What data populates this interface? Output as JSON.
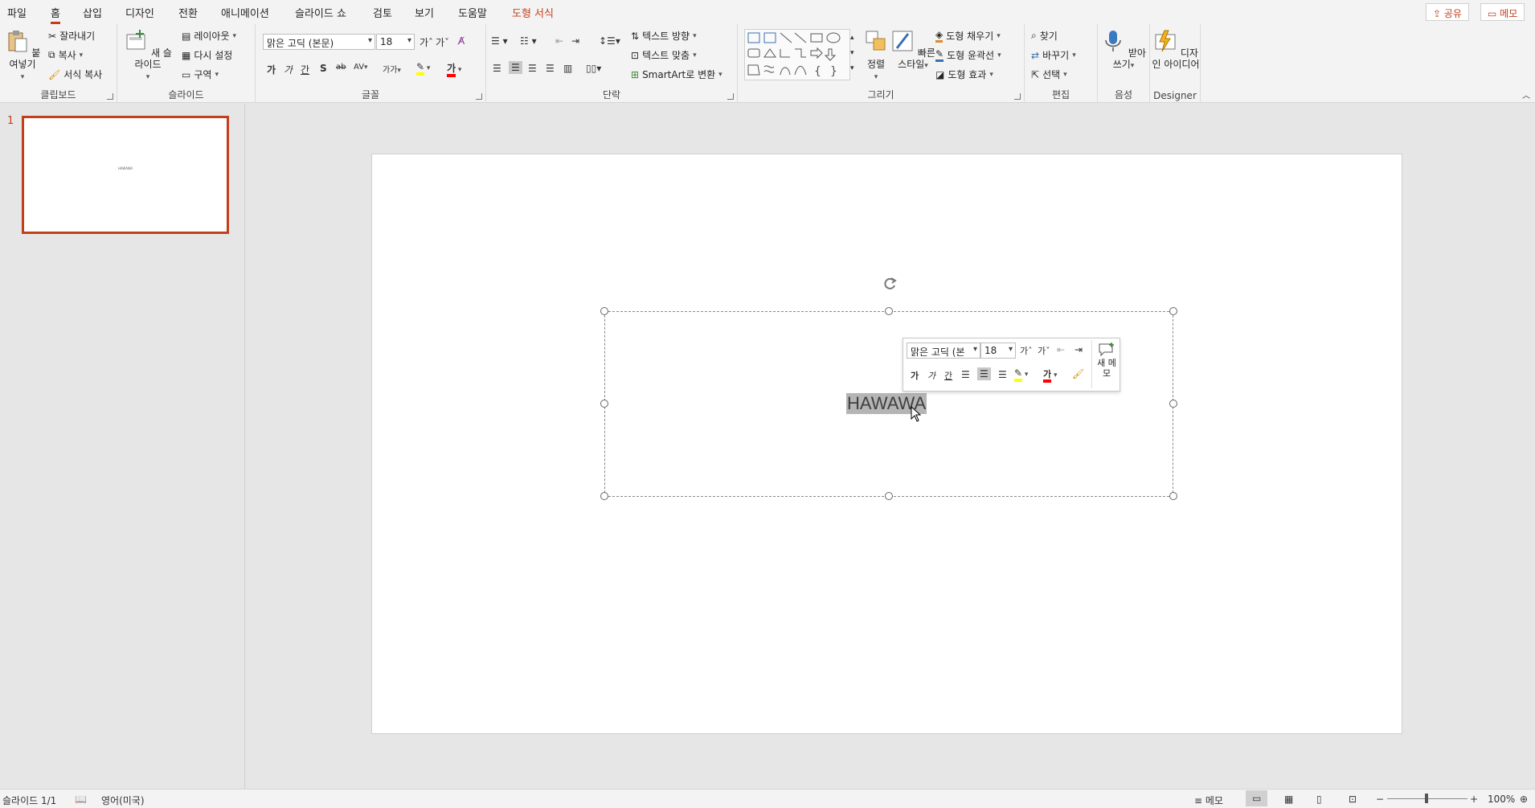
{
  "tabs": [
    "파일",
    "홈",
    "삽입",
    "디자인",
    "전환",
    "애니메이션",
    "슬라이드 쇼",
    "검토",
    "보기",
    "도움말",
    "도형 서식"
  ],
  "top_right": {
    "share": "공유",
    "memo": "메모"
  },
  "ribbon": {
    "clipboard": {
      "label": "클립보드",
      "paste": "붙여넣기",
      "cut": "잘라내기",
      "copy": "복사",
      "format_painter": "서식 복사"
    },
    "slides": {
      "label": "슬라이드",
      "new_slide": "새 슬라이드",
      "layout": "레이아웃",
      "reset": "다시 설정",
      "section": "구역"
    },
    "font": {
      "label": "글꼴",
      "font_name": "맑은 고딕 (본문)",
      "font_size": "18",
      "bold": "가",
      "italic": "가",
      "underline": "간",
      "shadow": "S",
      "strike": "ab",
      "spacing": "AV",
      "case": "가가"
    },
    "paragraph": {
      "label": "단락",
      "text_direction": "텍스트 방향",
      "align_text": "텍스트 맞춤",
      "smartart": "SmartArt로 변환"
    },
    "drawing": {
      "label": "그리기",
      "arrange": "정렬",
      "quick_styles": "빠른 스타일",
      "fill": "도형 채우기",
      "outline": "도형 윤곽선",
      "effects": "도형 효과"
    },
    "editing": {
      "label": "편집",
      "find": "찾기",
      "replace": "바꾸기",
      "select": "선택"
    },
    "voice": {
      "label": "음성",
      "dictate": "받아 쓰기"
    },
    "designer": {
      "label": "Designer",
      "ideas": "디자인 아이디어"
    }
  },
  "thumbnail": {
    "number": "1",
    "text": "HAWAWA"
  },
  "slide": {
    "text": "HAWAWA"
  },
  "mini_toolbar": {
    "font_name": "맑은 고딕 (본",
    "font_size": "18",
    "new_memo": "새 메모"
  },
  "status": {
    "slide": "슬라이드 1/1",
    "language": "영어(미국)",
    "notes": "메모",
    "zoom": "100%"
  },
  "colors": {
    "accent": "#c43e1c",
    "highlight": "#ffff00",
    "font_color": "#ff0000"
  }
}
